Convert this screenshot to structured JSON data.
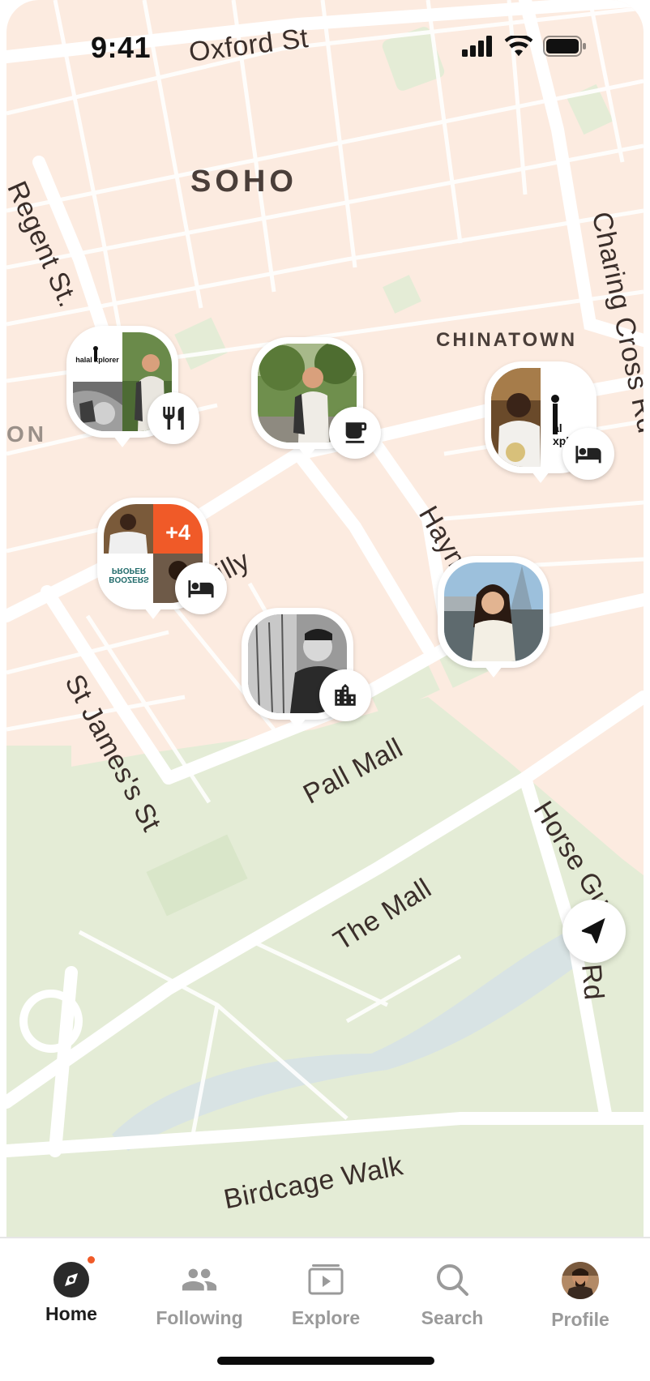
{
  "status_bar": {
    "time": "9:41"
  },
  "map": {
    "districts": {
      "soho": "SOHO",
      "chinatown": "CHINATOWN",
      "left_partial": "ON"
    },
    "streets": {
      "oxford": "Oxford St",
      "regent": "Regent St.",
      "charing": "Charing Cross Rd",
      "piccadilly": "illy",
      "haymarket": "Haym",
      "st_james": "St James's St",
      "pall_mall": "Pall Mall",
      "the_mall": "The Mall",
      "horse_guards": "Horse Gu",
      "horse_guards_rd": "Rd",
      "birdcage": "Birdcage Walk"
    },
    "pins": {
      "pin1": {
        "logo_text": "halal xplorer",
        "category_icon": "restaurant-icon"
      },
      "pin2": {
        "category_icon": "coffee-icon"
      },
      "pin3": {
        "logo_text": "al xplo",
        "category_icon": "hotel-bed-icon"
      },
      "pin4": {
        "more_count": "+4",
        "sign_text": "BOOZERS PROPER",
        "category_icon": "hotel-bed-icon"
      },
      "pin5": {
        "category_icon": "building-icon"
      },
      "pin6": {
        "category_icon": ""
      }
    }
  },
  "tabbar": {
    "home": "Home",
    "following": "Following",
    "explore": "Explore",
    "search": "Search",
    "profile": "Profile"
  },
  "colors": {
    "map_bg": "#fcebe0",
    "road": "#ffffff",
    "park": "#e4ecd6",
    "water": "#d8e3e4",
    "accent": "#f05a28"
  }
}
